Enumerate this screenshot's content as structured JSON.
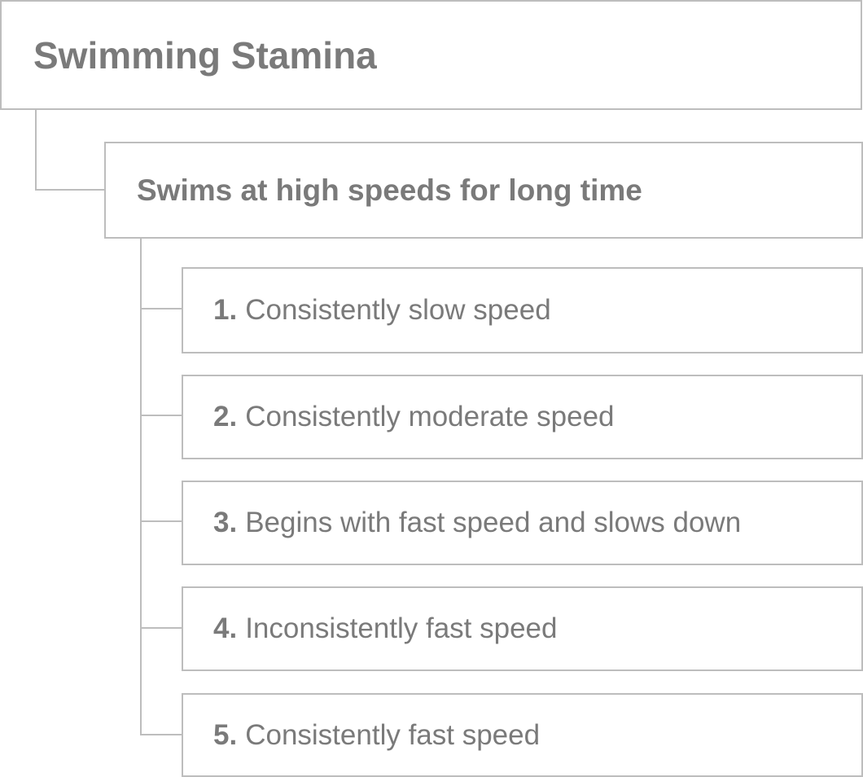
{
  "root": {
    "title": "Swimming Stamina"
  },
  "criterion": {
    "label": "Swims at high speeds for long time"
  },
  "levels": [
    {
      "number": "1.",
      "label": "Consistently slow speed"
    },
    {
      "number": "2.",
      "label": "Consistently moderate speed"
    },
    {
      "number": "3.",
      "label": "Begins with fast speed and slows down"
    },
    {
      "number": "4.",
      "label": "Inconsistently fast speed"
    },
    {
      "number": "5.",
      "label": "Consistently fast speed"
    }
  ],
  "colors": {
    "border": "#bdbdbd",
    "text": "#7a7a7a",
    "background": "#ffffff"
  }
}
